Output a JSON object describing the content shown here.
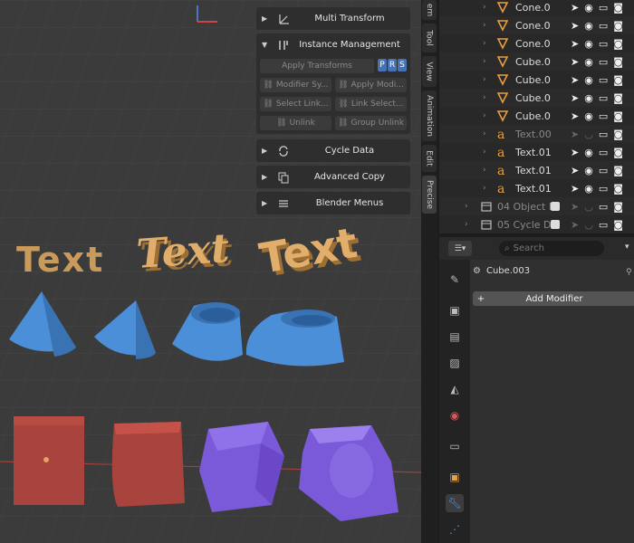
{
  "npanel": {
    "multi_transform": "Multi Transform",
    "instance_management": "Instance Management",
    "apply_transforms": "Apply Transforms",
    "prs": [
      "P",
      "R",
      "S"
    ],
    "modifier_sync": "Modifier Sy...",
    "apply_modifiers": "Apply Modi...",
    "select_linked": "Select Link...",
    "link_selected": "Link Select...",
    "unlink": "Unlink",
    "group_unlink": "Group Unlink",
    "cycle_data": "Cycle Data",
    "advanced_copy": "Advanced Copy",
    "blender_menus": "Blender Menus"
  },
  "vtabs": [
    "em",
    "Tool",
    "View",
    "Animation",
    "Edit",
    "Precise"
  ],
  "viewport_text": [
    "Text",
    "Text",
    "Text"
  ],
  "outliner": {
    "rows": [
      {
        "label": "Cone.0",
        "icon": "cone-icon",
        "dim": false
      },
      {
        "label": "Cone.0",
        "icon": "cone-icon",
        "dim": false
      },
      {
        "label": "Cone.0",
        "icon": "cone-icon",
        "dim": false
      },
      {
        "label": "Cube.0",
        "icon": "cone-icon",
        "dim": false
      },
      {
        "label": "Cube.0",
        "icon": "cone-icon",
        "dim": false
      },
      {
        "label": "Cube.0",
        "icon": "cone-icon",
        "dim": false
      },
      {
        "label": "Cube.0",
        "icon": "cone-icon",
        "dim": false
      },
      {
        "label": "Text.00",
        "icon": "text-object-icon",
        "dim": true
      },
      {
        "label": "Text.01",
        "icon": "text-object-icon",
        "dim": false
      },
      {
        "label": "Text.01",
        "icon": "text-object-icon",
        "dim": false
      },
      {
        "label": "Text.01",
        "icon": "text-object-icon",
        "dim": false
      },
      {
        "label": "04 Object I",
        "icon": "collection-icon",
        "dim": true
      },
      {
        "label": "05 Cycle D",
        "icon": "collection-icon",
        "dim": true
      }
    ]
  },
  "properties": {
    "search_placeholder": "Search",
    "object_name": "Cube.003",
    "add_modifier": "Add Modifier"
  }
}
